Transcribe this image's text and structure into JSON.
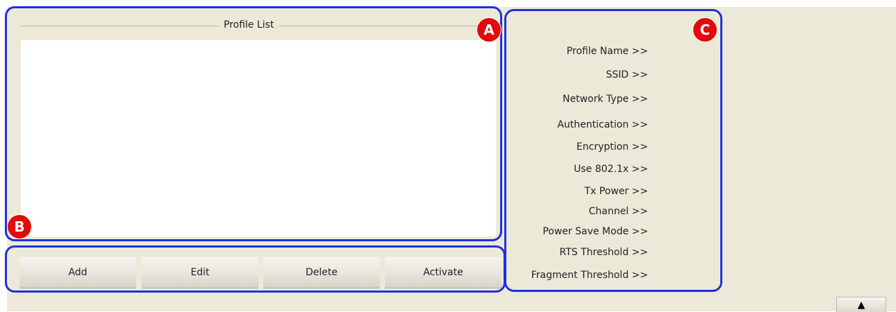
{
  "profile_list": {
    "title": "Profile List",
    "items": []
  },
  "buttons": {
    "add": "Add",
    "edit": "Edit",
    "delete": "Delete",
    "activate": "Activate"
  },
  "details": {
    "profile_name": "Profile Name >>",
    "ssid": "SSID >>",
    "network_type": "Network Type >>",
    "authentication": "Authentication >>",
    "encryption": "Encryption >>",
    "use_8021x": "Use 802.1x >>",
    "tx_power": "Tx Power >>",
    "channel": "Channel >>",
    "power_save_mode": "Power Save Mode >>",
    "rts_threshold": "RTS Threshold >>",
    "fragment_threshold": "Fragment Threshold >>"
  },
  "annotations": {
    "a": "A",
    "b": "B",
    "c": "C",
    "outline_color": "#1f2fe0",
    "marker_color": "#e10b0b"
  },
  "expand_button": {
    "icon": "triangle-up-icon",
    "glyph": "▲"
  },
  "colors": {
    "window_bg": "#ECE9D8",
    "list_bg": "#ffffff"
  }
}
